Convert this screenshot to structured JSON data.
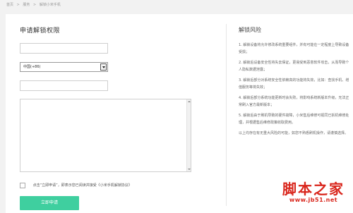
{
  "breadcrumb": [
    "首页",
    ">",
    "服务",
    ">",
    "解锁小米手机"
  ],
  "form": {
    "title": "申请解锁权限",
    "country_select": "中国(+86)",
    "agreement_text": "点击“立即申请”，即表示您已阅读并接受《小米手机解锁协议》",
    "submit_label": "立即申请"
  },
  "risk": {
    "title": "解锁风险",
    "items": [
      "1. 解锁设备将允许修改系统重要组件，并有可能在一定程度上导致设备受损；",
      "2. 解锁后设备安全性将失去保证，更易受到恶意软件攻击，从而导致个人隐私数据泄露；",
      "3. 解锁后部分对系统安全性依赖高的功能将失效，比如：查找手机、增值服务等将失效；",
      "4. 解锁后部分系统功能更新时会失败，将影响系统新版本升级，无法正常刷入官方最新版本；",
      "5. 解锁后由于刷机导致的硬件故障，小米售后维修可视同已拆机维修处理，并根据售后维修政策收取费用。",
      "以上均存在有无重大风险的可能，如您不熟悉刷机操作，请谨慎选择。"
    ]
  },
  "watermark": {
    "title": "脚本之家",
    "url": "www.jb51.net"
  }
}
